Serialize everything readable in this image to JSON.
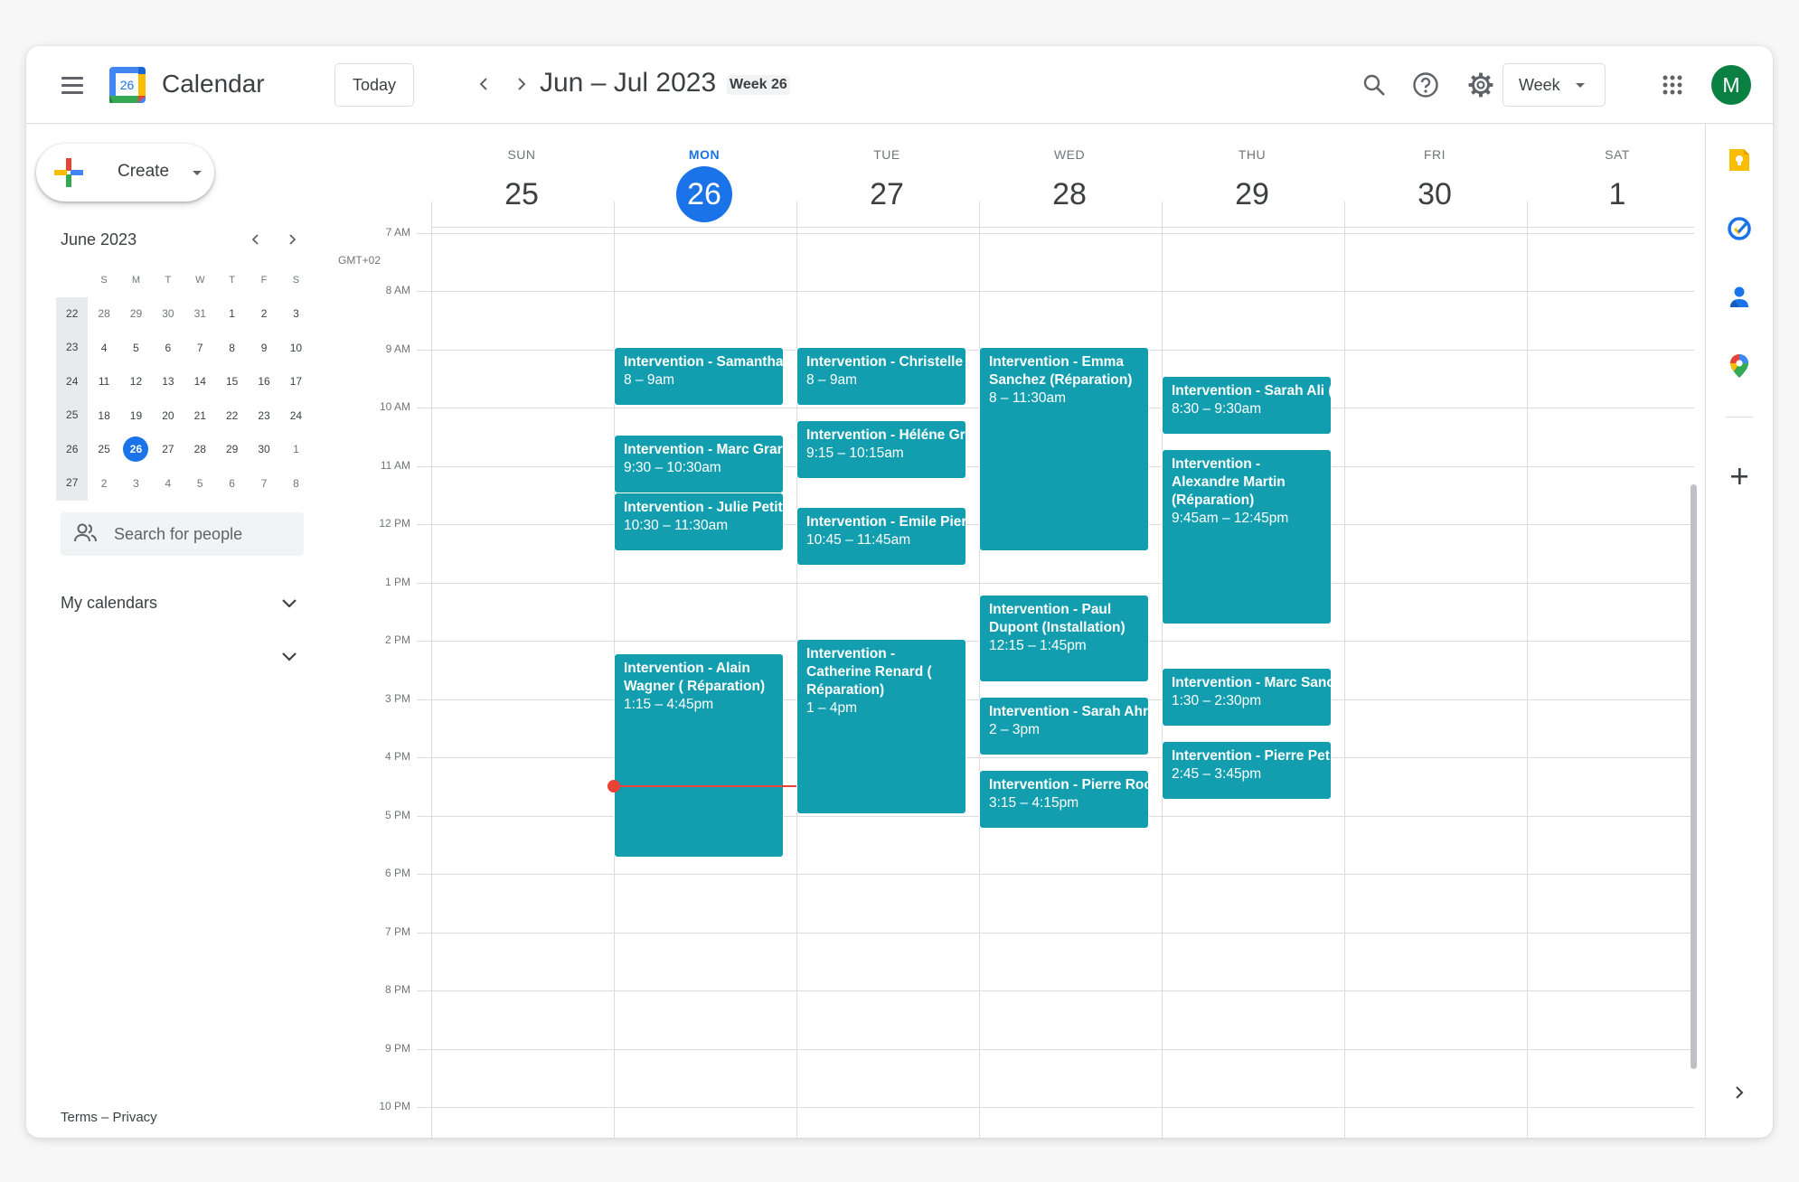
{
  "header": {
    "app_title": "Calendar",
    "logo_text": "26",
    "today_label": "Today",
    "date_range": "Jun – Jul 2023",
    "week_badge": "Week 26",
    "view_label": "Week",
    "avatar_initial": "M"
  },
  "sidebar": {
    "create_label": "Create",
    "mini_calendar": {
      "title": "June 2023",
      "weekday_headers": [
        "S",
        "M",
        "T",
        "W",
        "T",
        "F",
        "S"
      ],
      "weeks": [
        {
          "week": "22",
          "days": [
            "28",
            "29",
            "30",
            "31",
            "1",
            "2",
            "3"
          ]
        },
        {
          "week": "23",
          "days": [
            "4",
            "5",
            "6",
            "7",
            "8",
            "9",
            "10"
          ]
        },
        {
          "week": "24",
          "days": [
            "11",
            "12",
            "13",
            "14",
            "15",
            "16",
            "17"
          ]
        },
        {
          "week": "25",
          "days": [
            "18",
            "19",
            "20",
            "21",
            "22",
            "23",
            "24"
          ]
        },
        {
          "week": "26",
          "days": [
            "25",
            "26",
            "27",
            "28",
            "29",
            "30",
            "1"
          ]
        },
        {
          "week": "27",
          "days": [
            "2",
            "3",
            "4",
            "5",
            "6",
            "7",
            "8"
          ]
        }
      ],
      "selected_day": "26"
    },
    "people_search_placeholder": "Search for people",
    "my_calendars_label": "My calendars",
    "footer": "Terms – Privacy"
  },
  "grid": {
    "timezone": "GMT+02",
    "days": [
      {
        "name": "SUN",
        "num": "25"
      },
      {
        "name": "MON",
        "num": "26"
      },
      {
        "name": "TUE",
        "num": "27"
      },
      {
        "name": "WED",
        "num": "28"
      },
      {
        "name": "THU",
        "num": "29"
      },
      {
        "name": "FRI",
        "num": "30"
      },
      {
        "name": "SAT",
        "num": "1"
      }
    ],
    "hours": [
      "7 AM",
      "8 AM",
      "9 AM",
      "10 AM",
      "11 AM",
      "12 PM",
      "1 PM",
      "2 PM",
      "3 PM",
      "4 PM",
      "5 PM",
      "6 PM",
      "7 PM",
      "8 PM",
      "9 PM",
      "10 PM"
    ]
  },
  "events": {
    "mon_1": {
      "title": "Intervention - Samantha",
      "time": "8 – 9am"
    },
    "mon_2": {
      "title": "Intervention - Marc Grar",
      "time": "9:30 – 10:30am"
    },
    "mon_3": {
      "title": "Intervention - Julie Petit",
      "time": "10:30 – 11:30am"
    },
    "mon_4": {
      "title": "Intervention - Alain Wagner ( Réparation)",
      "time": "1:15 – 4:45pm"
    },
    "tue_1": {
      "title": "Intervention - Christelle",
      "time": "8 – 9am"
    },
    "tue_2": {
      "title": "Intervention - Héléne Gr",
      "time": "9:15 – 10:15am"
    },
    "tue_3": {
      "title": "Intervention - Emile Pier",
      "time": "10:45 – 11:45am"
    },
    "tue_4": {
      "title": "Intervention - Catherine Renard ( Réparation)",
      "time": "1 – 4pm"
    },
    "wed_1": {
      "title": "Intervention - Emma Sanchez (Réparation)",
      "time": "8 – 11:30am"
    },
    "wed_2": {
      "title": "Intervention - Paul Dupont (Installation)",
      "time": "12:15 – 1:45pm"
    },
    "wed_3": {
      "title": "Intervention - Sarah Ahr",
      "time": "2 – 3pm"
    },
    "wed_4": {
      "title": "Intervention - Pierre Roc",
      "time": "3:15 – 4:15pm"
    },
    "thu_1": {
      "title": "Intervention - Sarah Ali (",
      "time": "8:30 – 9:30am"
    },
    "thu_2": {
      "title": "Intervention - Alexandre Martin (Réparation)",
      "time": "9:45am – 12:45pm"
    },
    "thu_3": {
      "title": "Intervention - Marc Sanc",
      "time": "1:30 – 2:30pm"
    },
    "thu_4": {
      "title": "Intervention - Pierre Pet",
      "time": "2:45 – 3:45pm"
    }
  },
  "colors": {
    "event": "#129eaf",
    "accent": "#1a73e8",
    "now_indicator": "#ea4335",
    "avatar": "#0b8043"
  },
  "icons": {
    "header": [
      "menu-icon",
      "search-icon",
      "help-icon",
      "settings-icon",
      "apps-grid-icon"
    ],
    "rail": [
      "keep-icon",
      "tasks-icon",
      "contacts-icon",
      "maps-icon",
      "add-icon",
      "expand-icon"
    ]
  }
}
